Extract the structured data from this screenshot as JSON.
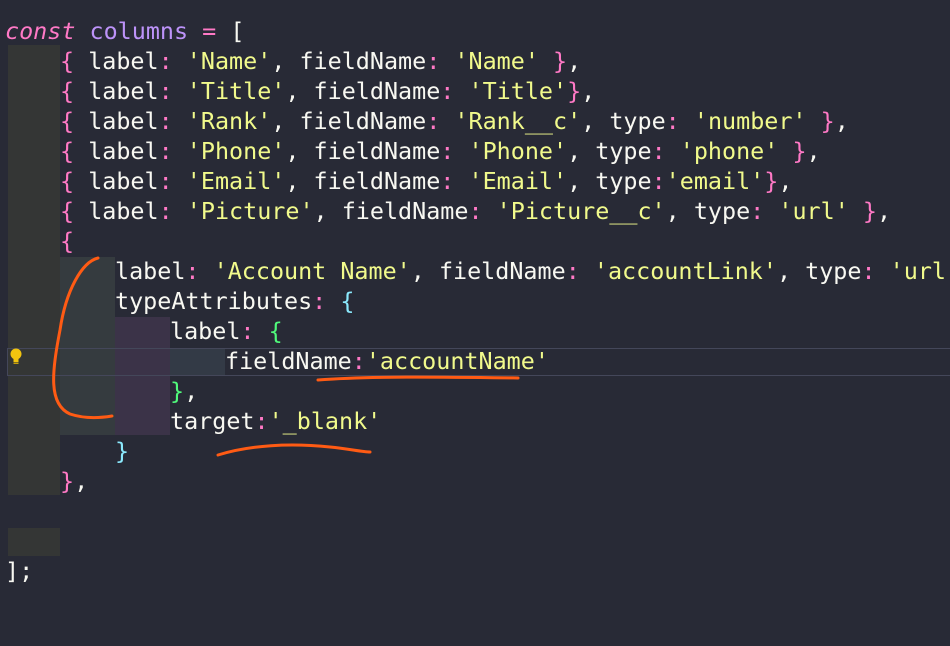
{
  "editor": {
    "line1": {
      "kw": "const",
      "name": "columns",
      "eq": " = ",
      "open": "["
    },
    "line2": {
      "k1": "label",
      "v1": "'Name'",
      "k2": "fieldName",
      "v2": "'Name'"
    },
    "line3": {
      "k1": "label",
      "v1": "'Title'",
      "k2": "fieldName",
      "v2": "'Title'"
    },
    "line4": {
      "k1": "label",
      "v1": "'Rank'",
      "k2": "fieldName",
      "v2": "'Rank__c'",
      "k3": "type",
      "v3": "'number'"
    },
    "line5": {
      "k1": "label",
      "v1": "'Phone'",
      "k2": "fieldName",
      "v2": "'Phone'",
      "k3": "type",
      "v3": "'phone'"
    },
    "line6": {
      "k1": "label",
      "v1": "'Email'",
      "k2": "fieldName",
      "v2": "'Email'",
      "k3": "type",
      "v3": "'email'"
    },
    "line7": {
      "k1": "label",
      "v1": "'Picture'",
      "k2": "fieldName",
      "v2": "'Picture__c'",
      "k3": "type",
      "v3": "'url'"
    },
    "line9": {
      "k1": "label",
      "v1": "'Account Name'",
      "k2": "fieldName",
      "v2": "'accountLink'",
      "k3": "type",
      "v3": "'url'"
    },
    "line10": {
      "k1": "typeAttributes"
    },
    "line11": {
      "k1": "label"
    },
    "line12": {
      "k1": "fieldName",
      "v1": "'accountName'"
    },
    "line14": {
      "k1": "target",
      "v1": "'_blank'"
    },
    "line19": {
      "text": "];"
    }
  },
  "annotation": {
    "color": "#ff5b14"
  }
}
